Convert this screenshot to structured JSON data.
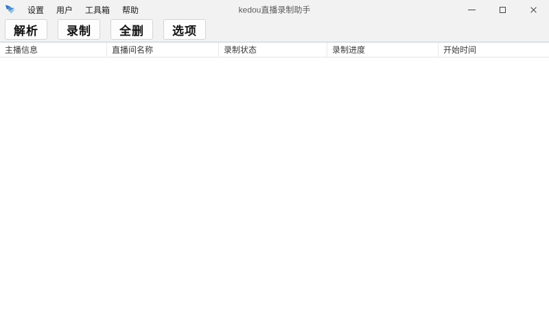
{
  "window": {
    "title": "kedou直播录制助手"
  },
  "menu": {
    "items": [
      {
        "label": "设置"
      },
      {
        "label": "用户"
      },
      {
        "label": "工具箱"
      },
      {
        "label": "帮助"
      }
    ]
  },
  "toolbar": {
    "buttons": [
      {
        "label": "解析"
      },
      {
        "label": "录制"
      },
      {
        "label": "全删"
      },
      {
        "label": "选项"
      }
    ]
  },
  "table": {
    "columns": [
      {
        "label": "主播信息"
      },
      {
        "label": "直播间名称"
      },
      {
        "label": "录制状态"
      },
      {
        "label": "录制进度"
      },
      {
        "label": "开始时间"
      }
    ],
    "rows": []
  },
  "icons": {
    "app_logo": "kedou-tadpole-logo",
    "minimize": "horizontal-line",
    "maximize": "square-outline",
    "close": "x-cross"
  },
  "colors": {
    "chrome_bg": "#f2f2f2",
    "body_bg": "#ffffff",
    "header_top_border": "#c3ccd4",
    "header_bottom_border": "#e4e4e4",
    "button_bg": "#fdfdfd",
    "button_border": "#d4d4d4",
    "logo_blue_dark": "#2e6db4",
    "logo_blue_mid": "#4a90d9",
    "logo_blue_light": "#8ec1ea"
  }
}
